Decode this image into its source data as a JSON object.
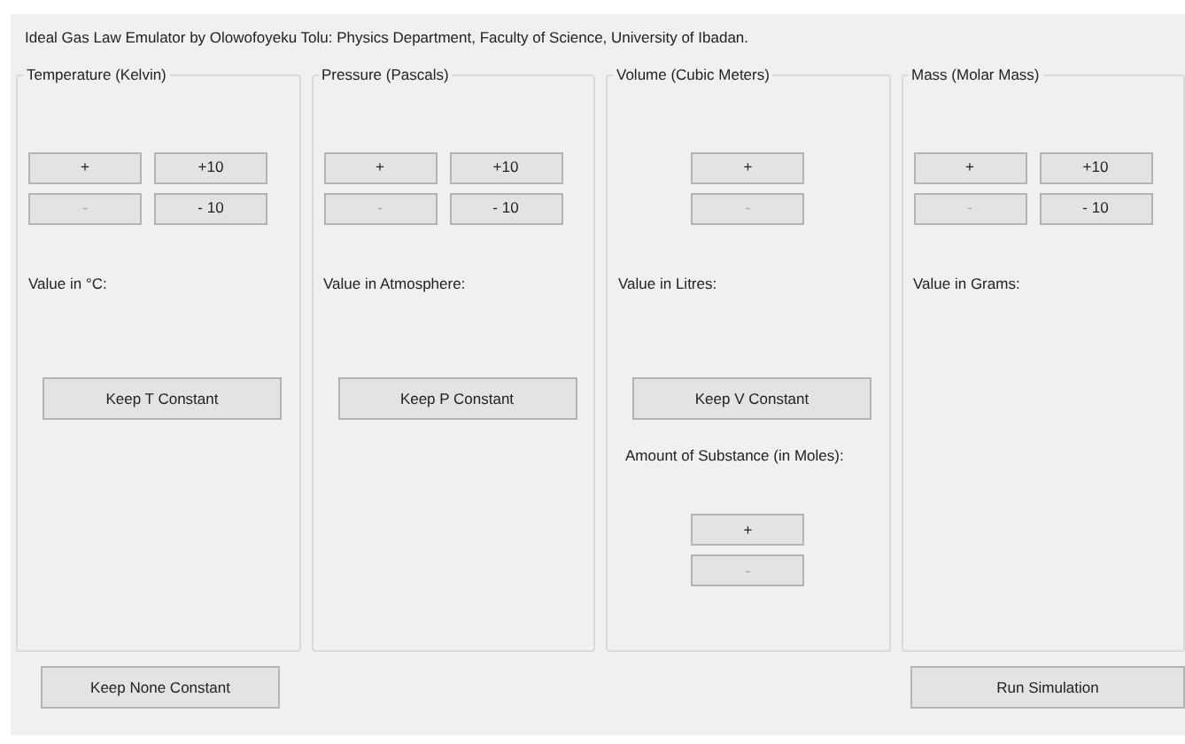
{
  "window": {
    "title": "Ideal Gas Law Emulator by Olowofoyeku Tolu: Physics Department, Faculty of Science, University of Ibadan."
  },
  "groups": [
    {
      "title": "Temperature (Kelvin)",
      "buttons": [
        {
          "label": "+",
          "disabled": false
        },
        {
          "label": "+10",
          "disabled": false
        },
        {
          "label": "-",
          "disabled": true
        },
        {
          "label": "- 10",
          "disabled": false
        }
      ],
      "value_label": "Value in °C:",
      "keep_button": "Keep T Constant"
    },
    {
      "title": "Pressure (Pascals)",
      "buttons": [
        {
          "label": "+",
          "disabled": false
        },
        {
          "label": "+10",
          "disabled": false
        },
        {
          "label": "-",
          "disabled": true
        },
        {
          "label": "- 10",
          "disabled": false
        }
      ],
      "value_label": "Value in Atmosphere:",
      "keep_button": "Keep P Constant"
    },
    {
      "title": "Volume (Cubic Meters)",
      "buttons": [
        {
          "label": "+",
          "disabled": false
        },
        {
          "label": "-",
          "disabled": true
        }
      ],
      "value_label": "Value in Litres:",
      "keep_button": "Keep V Constant",
      "amount_label": "Amount of Substance (in Moles):",
      "amount_buttons": [
        {
          "label": "+",
          "disabled": false
        },
        {
          "label": "-",
          "disabled": true
        }
      ]
    },
    {
      "title": "Mass (Molar Mass)",
      "buttons": [
        {
          "label": "+",
          "disabled": false
        },
        {
          "label": "+10",
          "disabled": false
        },
        {
          "label": "-",
          "disabled": true
        },
        {
          "label": "- 10",
          "disabled": false
        }
      ],
      "value_label": "Value in Grams:"
    }
  ],
  "footer": {
    "left_button": "Keep None Constant",
    "right_button": "Run Simulation"
  }
}
